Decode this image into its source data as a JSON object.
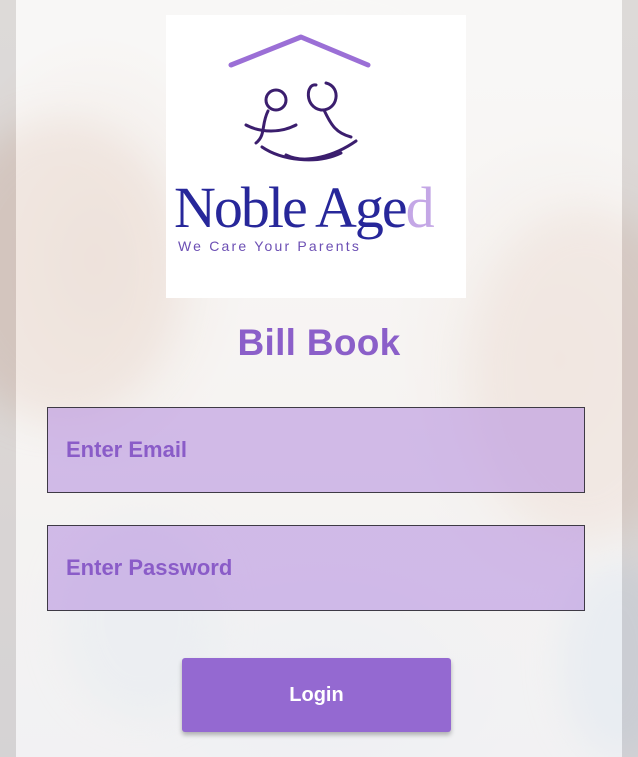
{
  "logo": {
    "brand_name": "Noble Aged",
    "brand_main": "Noble Age",
    "brand_tail": "d",
    "tagline": "We Care Your Parents",
    "primary_color": "#27279a",
    "accent_color": "#9b6fd6",
    "icon": "house-with-parents-icon"
  },
  "app": {
    "title": "Bill Book",
    "title_color": "#8b5fc9"
  },
  "form": {
    "email": {
      "placeholder": "Enter Email",
      "value": ""
    },
    "password": {
      "placeholder": "Enter Password",
      "value": ""
    },
    "login_label": "Login",
    "field_color": "#ba96e1",
    "button_color": "#9469d1"
  }
}
